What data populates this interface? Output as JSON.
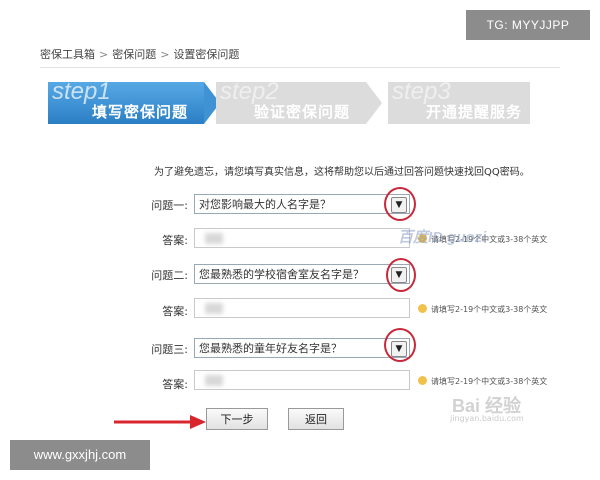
{
  "overlays": {
    "tg_badge": "TG: MYYJJPP",
    "site_badge": "www.gxxjhj.com",
    "watermark_baidu_id": "百度ID guozi",
    "watermark_baidu": "Bai 经验",
    "watermark_baidu_url": "jingyan.baidu.com"
  },
  "breadcrumb": {
    "items": [
      "密保工具箱",
      "密保问题",
      "设置密保问题"
    ],
    "separator": ">"
  },
  "steps": [
    {
      "tag": "step1",
      "label": "填写密保问题",
      "active": true
    },
    {
      "tag": "step2",
      "label": "验证密保问题",
      "active": false
    },
    {
      "tag": "step3",
      "label": "开通提醒服务",
      "active": false
    }
  ],
  "intro": "为了避免遗忘，请您填写真实信息，这将帮助您以后通过回答问题快速找回QQ密码。",
  "questions": [
    {
      "label": "问题一:",
      "value": "对您影响最大的人名字是？",
      "answer_label": "答案:",
      "hint": ""
    },
    {
      "label": "问题二:",
      "value": "您最熟悉的学校宿舍室友名字是？",
      "answer_label": "答案:",
      "hint": "请填写2-19个中文或3-38个英文"
    },
    {
      "label": "问题三:",
      "value": "您最熟悉的童年好友名字是？",
      "answer_label": "答案:",
      "hint": "请填写2-19个中文或3-38个英文"
    }
  ],
  "first_hint": "请填写2-19个中文或3-38个英文",
  "buttons": {
    "next": "下一步",
    "back": "返回"
  },
  "colors": {
    "accent": "#2b7fc4",
    "highlight": "#c8283a"
  }
}
